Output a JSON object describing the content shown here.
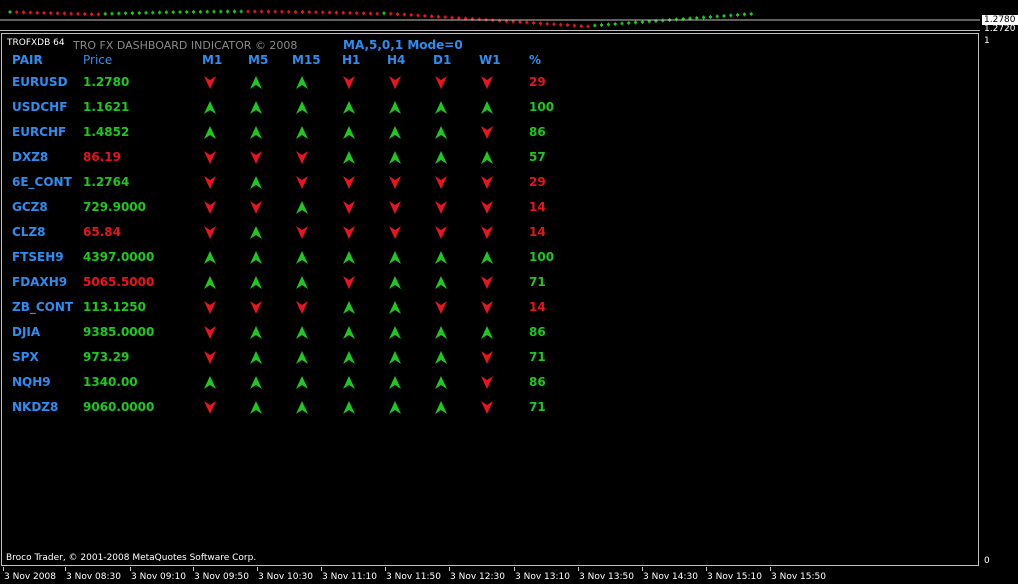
{
  "price_axis": {
    "price1": "1.2780",
    "price2": "1.2720",
    "ind_top": "1",
    "ind_bottom": "0"
  },
  "window_label": "TROFXDB 64",
  "indicator_title": "TRO FX DASHBOARD INDICATOR © 2008",
  "mode_label": "MA,5,0,1 Mode=0",
  "headers": {
    "pair": "PAIR",
    "price": "Price",
    "m1": "M1",
    "m5": "M5",
    "m15": "M15",
    "h1": "H1",
    "h4": "H4",
    "d1": "D1",
    "w1": "W1",
    "pct": "%"
  },
  "colors": {
    "up": "#1ec81e",
    "down": "#e8141e",
    "blue": "#2e8ef0"
  },
  "rows": [
    {
      "pair": "EURUSD",
      "price": "1.2780",
      "price_color": "up",
      "dirs": [
        "down",
        "up",
        "up",
        "down",
        "down",
        "down",
        "down"
      ],
      "pct": "29",
      "pct_color": "down"
    },
    {
      "pair": "USDCHF",
      "price": "1.1621",
      "price_color": "up",
      "dirs": [
        "up",
        "up",
        "up",
        "up",
        "up",
        "up",
        "up"
      ],
      "pct": "100",
      "pct_color": "up"
    },
    {
      "pair": "EURCHF",
      "price": "1.4852",
      "price_color": "up",
      "dirs": [
        "up",
        "up",
        "up",
        "up",
        "up",
        "up",
        "down"
      ],
      "pct": "86",
      "pct_color": "up"
    },
    {
      "pair": "DXZ8",
      "price": "86.19",
      "price_color": "down",
      "dirs": [
        "down",
        "down",
        "down",
        "up",
        "up",
        "up",
        "up"
      ],
      "pct": "57",
      "pct_color": "up"
    },
    {
      "pair": "6E_CONT",
      "price": "1.2764",
      "price_color": "up",
      "dirs": [
        "down",
        "up",
        "down",
        "down",
        "down",
        "down",
        "down"
      ],
      "pct": "29",
      "pct_color": "down"
    },
    {
      "pair": "GCZ8",
      "price": "729.9000",
      "price_color": "up",
      "dirs": [
        "down",
        "down",
        "up",
        "down",
        "down",
        "down",
        "down"
      ],
      "pct": "14",
      "pct_color": "down"
    },
    {
      "pair": "CLZ8",
      "price": "65.84",
      "price_color": "down",
      "dirs": [
        "down",
        "up",
        "down",
        "down",
        "down",
        "down",
        "down"
      ],
      "pct": "14",
      "pct_color": "down"
    },
    {
      "pair": "FTSEH9",
      "price": "4397.0000",
      "price_color": "up",
      "dirs": [
        "up",
        "up",
        "up",
        "up",
        "up",
        "up",
        "up"
      ],
      "pct": "100",
      "pct_color": "up"
    },
    {
      "pair": "FDAXH9",
      "price": "5065.5000",
      "price_color": "down",
      "dirs": [
        "up",
        "up",
        "up",
        "down",
        "up",
        "up",
        "down"
      ],
      "pct": "71",
      "pct_color": "up"
    },
    {
      "pair": "ZB_CONT",
      "price": "113.1250",
      "price_color": "up",
      "dirs": [
        "down",
        "down",
        "down",
        "up",
        "up",
        "down",
        "down"
      ],
      "pct": "14",
      "pct_color": "down"
    },
    {
      "pair": "DJIA",
      "price": "9385.0000",
      "price_color": "up",
      "dirs": [
        "down",
        "up",
        "up",
        "up",
        "up",
        "up",
        "up"
      ],
      "pct": "86",
      "pct_color": "up"
    },
    {
      "pair": "SPX",
      "price": "973.29",
      "price_color": "up",
      "dirs": [
        "down",
        "up",
        "up",
        "up",
        "up",
        "up",
        "down"
      ],
      "pct": "71",
      "pct_color": "up"
    },
    {
      "pair": "NQH9",
      "price": "1340.00",
      "price_color": "up",
      "dirs": [
        "up",
        "up",
        "up",
        "up",
        "up",
        "up",
        "down"
      ],
      "pct": "86",
      "pct_color": "up"
    },
    {
      "pair": "NKDZ8",
      "price": "9060.0000",
      "price_color": "up",
      "dirs": [
        "down",
        "up",
        "up",
        "up",
        "up",
        "up",
        "down"
      ],
      "pct": "71",
      "pct_color": "up"
    }
  ],
  "copyright": "Broco Trader, © 2001-2008 MetaQuotes Software Corp.",
  "time_axis": [
    "3 Nov 2008",
    "3 Nov 08:30",
    "3 Nov 09:10",
    "3 Nov 09:50",
    "3 Nov 10:30",
    "3 Nov 11:10",
    "3 Nov 11:50",
    "3 Nov 12:30",
    "3 Nov 13:10",
    "3 Nov 13:50",
    "3 Nov 14:30",
    "3 Nov 15:10",
    "3 Nov 15:50"
  ]
}
